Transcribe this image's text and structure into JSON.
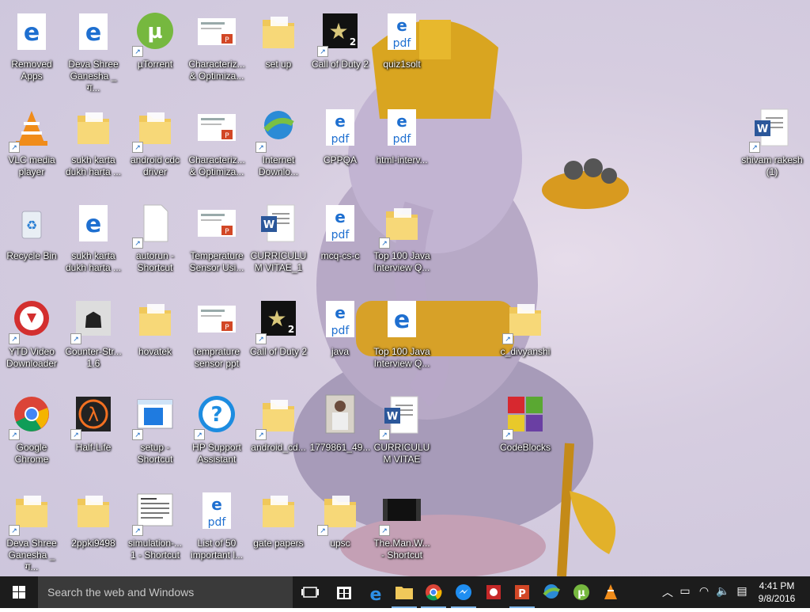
{
  "desktop": {
    "icons": [
      {
        "name": "removed-apps",
        "label": "Removed Apps",
        "icon": "edge-html-file-icon"
      },
      {
        "name": "deva-shree-ganesha-1",
        "label": "Deva Shree Ganesha _ ग...",
        "icon": "edge-html-file-icon"
      },
      {
        "name": "utorrent",
        "label": "µTorrent",
        "icon": "utorrent-icon"
      },
      {
        "name": "characterization-1",
        "label": "Characteriz... & Optimiza...",
        "icon": "powerpoint-file-icon"
      },
      {
        "name": "set-up",
        "label": "set up",
        "icon": "folder-icon"
      },
      {
        "name": "call-of-duty-2-a",
        "label": "Call of Duty 2",
        "icon": "call-of-duty-icon"
      },
      {
        "name": "quiz1solt",
        "label": "quiz1solt",
        "icon": "pdf-file-icon"
      },
      {
        "name": "vlc-media-player",
        "label": "VLC media player",
        "icon": "vlc-icon"
      },
      {
        "name": "sukh-karta-folder",
        "label": "sukh karta dukh harta ...",
        "icon": "folder-icon"
      },
      {
        "name": "android-cdc-driver",
        "label": "android cdc driver",
        "icon": "folder-icon"
      },
      {
        "name": "characterization-2",
        "label": "Characteriz... & Optimiza...",
        "icon": "powerpoint-file-icon"
      },
      {
        "name": "internet-download-manager",
        "label": "Internet Downlo...",
        "icon": "idm-icon"
      },
      {
        "name": "cppqa",
        "label": "CPPQA",
        "icon": "pdf-file-icon"
      },
      {
        "name": "html-interview",
        "label": "html-interv...",
        "icon": "pdf-file-icon"
      },
      {
        "name": "shivam-rakesh",
        "label": "shivam rakesh (1)",
        "icon": "word-document-icon"
      },
      {
        "name": "recycle-bin",
        "label": "Recycle Bin",
        "icon": "recycle-bin-icon"
      },
      {
        "name": "sukh-karta-html",
        "label": "sukh karta dukh harta ...",
        "icon": "edge-html-file-icon"
      },
      {
        "name": "autorun-shortcut",
        "label": "autorun - Shortcut",
        "icon": "blank-file-icon"
      },
      {
        "name": "temperature-sensor-1",
        "label": "Temperature Sensor Usi...",
        "icon": "powerpoint-file-icon"
      },
      {
        "name": "curriculum-vitae-1",
        "label": "CURRICULUM VITAE_1",
        "icon": "word-document-icon"
      },
      {
        "name": "mcq-cs-c",
        "label": "mcq-cs-c",
        "icon": "pdf-file-icon"
      },
      {
        "name": "top-100-java-1",
        "label": "Top 100 Java Interview Q...",
        "icon": "folder-icon"
      },
      {
        "name": "ytd-video-downloader",
        "label": "YTD Video Downloader",
        "icon": "ytd-icon"
      },
      {
        "name": "counter-strike",
        "label": "Counter-Str... 1.6",
        "icon": "counter-strike-icon"
      },
      {
        "name": "hovatek",
        "label": "hovatek",
        "icon": "folder-icon"
      },
      {
        "name": "temprature-sensor-ppt",
        "label": "temprature sensor ppt",
        "icon": "powerpoint-file-icon"
      },
      {
        "name": "call-of-duty-2-b",
        "label": "Call of Duty 2",
        "icon": "call-of-duty-icon"
      },
      {
        "name": "java",
        "label": "java",
        "icon": "pdf-file-icon"
      },
      {
        "name": "top-100-java-2",
        "label": "Top 100 Java Interview Q...",
        "icon": "edge-html-file-icon"
      },
      {
        "name": "c-divyanshi",
        "label": "c_divyanshi",
        "icon": "folder-icon"
      },
      {
        "name": "google-chrome",
        "label": "Google Chrome",
        "icon": "chrome-icon"
      },
      {
        "name": "half-life",
        "label": "Half-Life",
        "icon": "half-life-icon"
      },
      {
        "name": "setup-shortcut",
        "label": "setup - Shortcut",
        "icon": "setup-window-icon"
      },
      {
        "name": "hp-support-assistant",
        "label": "HP Support Assistant",
        "icon": "help-question-icon"
      },
      {
        "name": "android-cd",
        "label": "android_cd...",
        "icon": "folder-icon"
      },
      {
        "name": "photo-1779861",
        "label": "1779861_49...",
        "icon": "photo-thumbnail-icon"
      },
      {
        "name": "curriculum-vitae-2",
        "label": "CURRICULUM VITAE",
        "icon": "word-document-icon"
      },
      {
        "name": "codeblocks",
        "label": "CodeBlocks",
        "icon": "codeblocks-icon"
      },
      {
        "name": "deva-shree-ganesha-2",
        "label": "Deva Shree Ganesha _ ग...",
        "icon": "folder-icon"
      },
      {
        "name": "2ppki9498",
        "label": "2ppki9498",
        "icon": "folder-icon"
      },
      {
        "name": "simulation-shortcut",
        "label": "simulation-... 1 - Shortcut",
        "icon": "document-thumbnail-icon"
      },
      {
        "name": "list-of-50",
        "label": "List of 50 important l...",
        "icon": "pdf-file-icon"
      },
      {
        "name": "gate-papers",
        "label": "gate papers",
        "icon": "folder-icon"
      },
      {
        "name": "upsc",
        "label": "upsc",
        "icon": "folder-icon"
      },
      {
        "name": "the-man-shortcut",
        "label": "The.Man.W... - Shortcut",
        "icon": "video-thumbnail-icon"
      }
    ]
  },
  "taskbar": {
    "search_placeholder": "Search the web and Windows",
    "apps": [
      {
        "name": "task-view",
        "icon": "task-view-icon"
      },
      {
        "name": "store",
        "icon": "store-icon"
      },
      {
        "name": "edge",
        "icon": "edge-icon"
      },
      {
        "name": "file-explorer",
        "icon": "folder-icon"
      },
      {
        "name": "chrome",
        "icon": "chrome-icon"
      },
      {
        "name": "messenger",
        "icon": "messenger-icon"
      },
      {
        "name": "app-red",
        "icon": "red-app-icon"
      },
      {
        "name": "powerpoint",
        "icon": "powerpoint-icon"
      },
      {
        "name": "idm",
        "icon": "idm-icon"
      },
      {
        "name": "utorrent",
        "icon": "utorrent-icon"
      },
      {
        "name": "vlc",
        "icon": "vlc-icon"
      }
    ],
    "clock": {
      "time": "4:41 PM",
      "date": "9/8/2016"
    },
    "accent": "#0078d7"
  }
}
